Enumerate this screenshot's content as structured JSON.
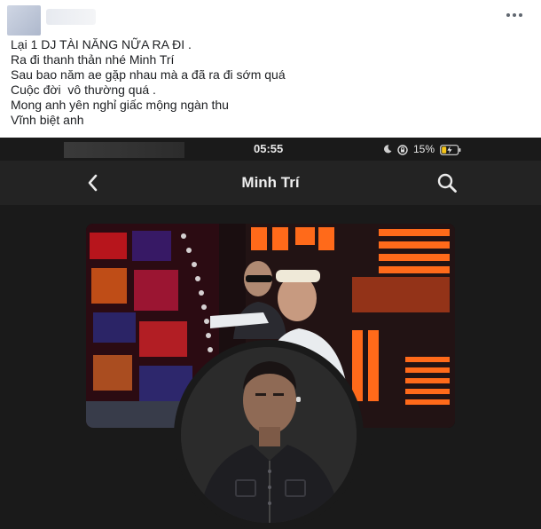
{
  "post": {
    "lines": [
      "Lại 1 DJ TÀI NĂNG NỮA RA ĐI .",
      "Ra đi thanh thản nhé Minh Trí",
      "Sau bao năm ae gặp nhau mà a đã ra đi sớm quá",
      "Cuộc đời  vô thường quá .",
      "Mong anh yên nghỉ giấc mộng ngàn thu",
      "Vĩnh biệt anh"
    ]
  },
  "status_bar": {
    "time": "05:55",
    "battery": "15%"
  },
  "profile": {
    "name": "Minh Trí"
  },
  "icons": {
    "more": "more-horizontal-icon",
    "back": "chevron-left-icon",
    "search": "search-icon",
    "moon": "moon-icon",
    "lock": "rotation-lock-icon",
    "battery": "battery-charging-icon"
  },
  "colors": {
    "page_bg": "#ffffff",
    "text": "#1c1e21",
    "screenshot_bg": "#1a1a1a",
    "topbar_bg": "#232323",
    "battery_accent": "#f5c518",
    "cover_orange": "#ff6a1a",
    "cover_red": "#d0181e"
  }
}
